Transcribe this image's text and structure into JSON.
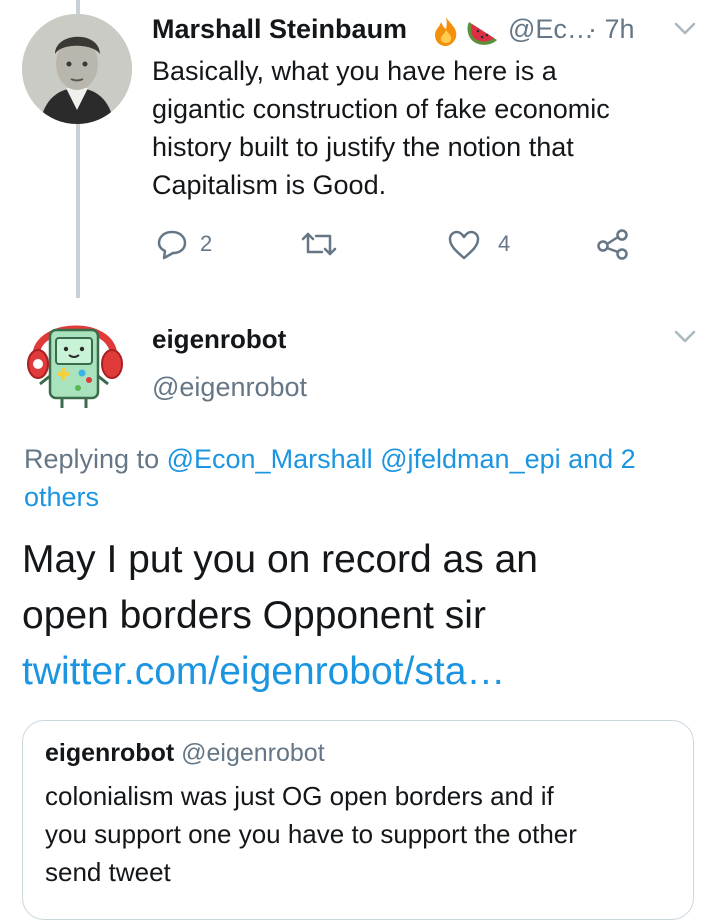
{
  "tweet1": {
    "author_name": "Marshall Steinbaum",
    "emoji": [
      "fire",
      "watermelon"
    ],
    "handle": "@Ec…",
    "time": "· 7h",
    "text_lines": [
      "Basically, what you have here is a",
      "gigantic construction of fake economic",
      "history built to justify the notion that",
      "Capitalism is Good."
    ],
    "reply_count": "2",
    "like_count": "4"
  },
  "tweet2": {
    "author_name": "eigenrobot",
    "handle": "@eigenrobot",
    "replying_prefix": "Replying to",
    "replying_line1": "@Econ_Marshall @jfeldman_epi and 2",
    "replying_line2": "others",
    "text_lines": [
      "May I put you on record as an",
      "open borders Opponent sir"
    ],
    "link": "twitter.com/eigenrobot/sta…"
  },
  "quoted": {
    "author_name": "eigenrobot",
    "handle": "@eigenrobot",
    "text_lines": [
      "colonialism was just OG open borders and if",
      "you support one you have to support the other",
      "send tweet"
    ]
  },
  "colors": {
    "link": "#1b95e0",
    "muted": "#657786",
    "thread_line": "#c8d0d6"
  }
}
